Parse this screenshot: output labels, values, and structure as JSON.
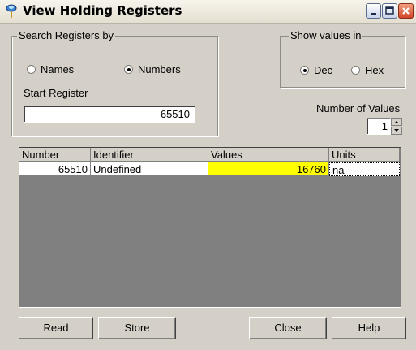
{
  "window": {
    "title": "View Holding Registers"
  },
  "title_buttons": [
    "minimize",
    "maximize",
    "close"
  ],
  "search_group": {
    "legend": "Search Registers by",
    "options": [
      {
        "label": "Names",
        "checked": false
      },
      {
        "label": "Numbers",
        "checked": true
      }
    ],
    "start_register_label": "Start Register",
    "start_register_value": "65510"
  },
  "show_values_group": {
    "legend": "Show values in",
    "options": [
      {
        "label": "Dec",
        "checked": true
      },
      {
        "label": "Hex",
        "checked": false
      }
    ]
  },
  "number_of_values": {
    "label": "Number of Values",
    "value": "1"
  },
  "table": {
    "columns": [
      "Number",
      "Identifier",
      "Values",
      "Units"
    ],
    "rows": [
      {
        "number": "65510",
        "identifier": "Undefined",
        "value": "16760",
        "units": "na"
      }
    ],
    "highlight_color": "#ffff00"
  },
  "buttons": {
    "read": "Read",
    "store": "Store",
    "close": "Close",
    "help": "Help"
  }
}
